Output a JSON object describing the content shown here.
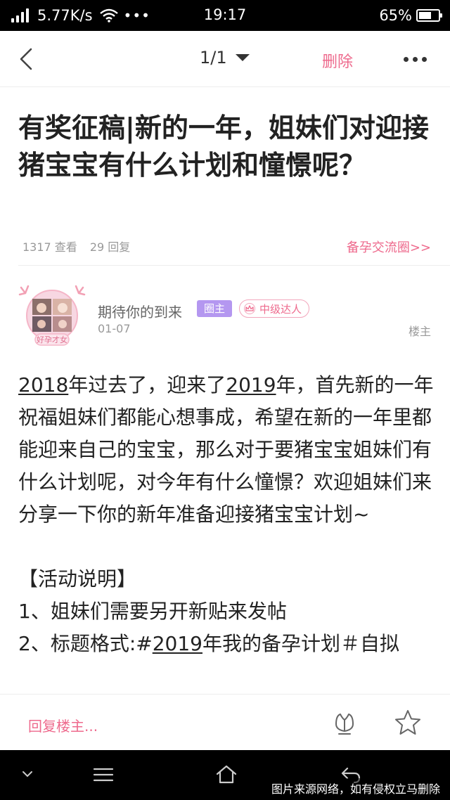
{
  "status_bar": {
    "network_speed": "5.77K/s",
    "dots": "•••",
    "time": "19:17",
    "battery_percent": "65%",
    "battery_level": 0.65
  },
  "nav": {
    "page_indicator": "1/1",
    "delete_label": "删除"
  },
  "post": {
    "title": "有奖征稿|新的一年，姐妹们对迎接猪宝宝有什么计划和憧憬呢？",
    "views": "1317 查看",
    "replies": "29 回复",
    "circle_link": "备孕交流圈>>",
    "author": {
      "name": "期待你的到来",
      "badge_owner": "圈主",
      "badge_level": "中级达人",
      "avatar_caption": "好孕才女"
    },
    "date": "01-07",
    "floor": "楼主",
    "body": {
      "p1_a": "2018",
      "p1_b": "年过去了，迎来了",
      "p1_c": "2019",
      "p1_d": "年，首先新的一年祝福姐妹们都能心想事成，希望在新的一年里都能迎来自己的宝宝，那么对于要猪宝宝姐妹们有什么计划呢，对今年有什么憧憬？欢迎姐妹们来分享一下你的新年准备迎接猪宝宝计划~",
      "heading": "【活动说明】",
      "item1": "1、姐妹们需要另开新贴来发帖",
      "item2_a": "2、标题格式:#",
      "item2_b": "2019",
      "item2_c": "年我的备孕计划＃自拟"
    }
  },
  "action_bar": {
    "reply_placeholder": "回复楼主..."
  },
  "watermark": "图片来源网络，如有侵权立马删除",
  "colors": {
    "accent_pink": "#ee6a8d",
    "badge_purple": "#b497f0"
  }
}
